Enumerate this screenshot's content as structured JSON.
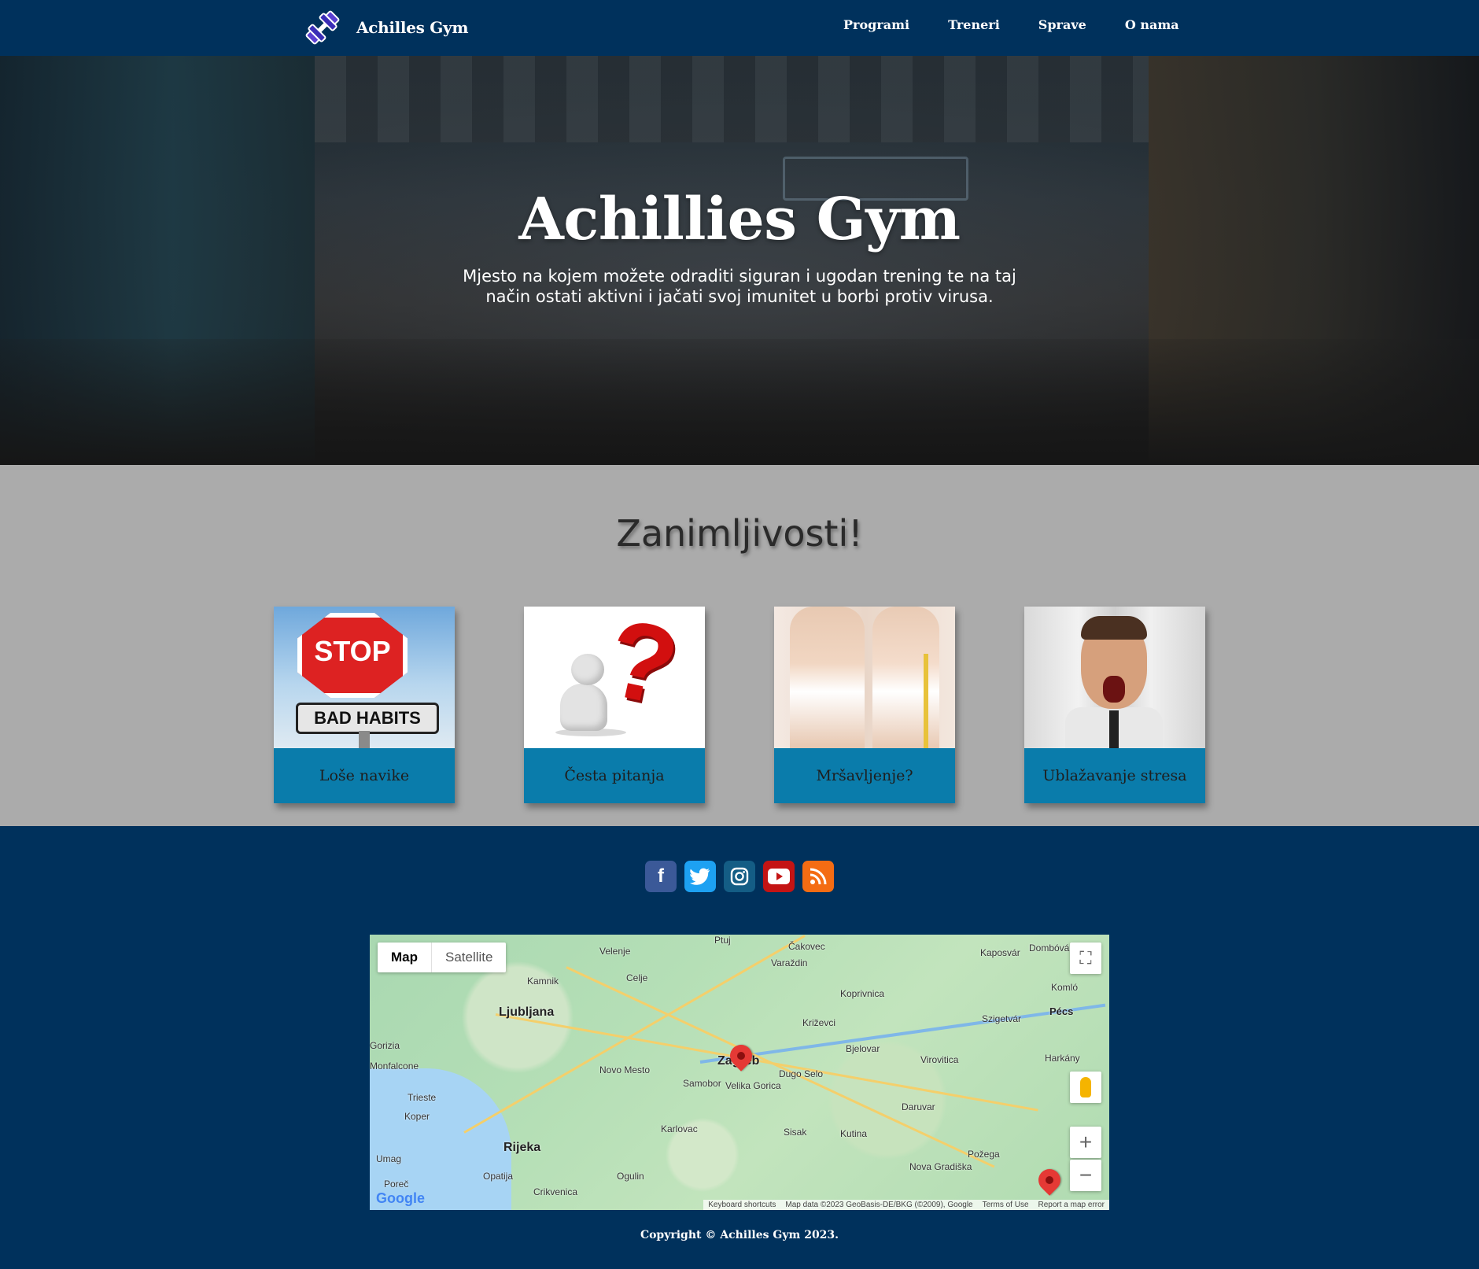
{
  "nav": {
    "brand": "Achilles Gym",
    "logo_icon": "dumbbell-logo-icon",
    "links": [
      "Programi",
      "Treneri",
      "Sprave",
      "O nama"
    ]
  },
  "hero": {
    "title": "Achillies Gym",
    "subtitle": "Mjesto na kojem možete odraditi siguran i ugodan trening te na taj način ostati aktivni i jačati svoj imunitet u borbi protiv virusa.",
    "image_text": [
      "STOP"
    ]
  },
  "section": {
    "title": "Zanimljivosti!",
    "cards": [
      {
        "label": "Loše navike",
        "image_text": "BAD HABITS"
      },
      {
        "label": "Česta pitanja"
      },
      {
        "label": "Mršavljenje?"
      },
      {
        "label": "Ublažavanje stresa"
      }
    ]
  },
  "footer": {
    "socials": [
      "facebook-icon",
      "twitter-icon",
      "instagram-icon",
      "youtube-icon",
      "rss-icon"
    ],
    "map": {
      "tab_map": "Map",
      "tab_satellite": "Satellite",
      "cities": [
        "Ljubljana",
        "Zagreb",
        "Rijeka",
        "Novo Mesto",
        "Samobor",
        "Velika Gorica",
        "Dugo Selo",
        "Karlovac",
        "Sisak",
        "Kutina",
        "Bjelovar",
        "Koprivnica",
        "Križevci",
        "Varaždin",
        "Čakovec",
        "Celje",
        "Kamnik",
        "Velenje",
        "Virovitica",
        "Daruvar",
        "Požega",
        "Nova Gradiška",
        "Pécs",
        "Kaposvár",
        "Szigetvár",
        "Harkány",
        "Trieste",
        "Koper",
        "Umag",
        "Poreč",
        "Opatija",
        "Crikvenica",
        "Ogulin",
        "Ptuj",
        "Dombóvár",
        "Komló",
        "Monfalcone",
        "Gorizia"
      ],
      "attribution": [
        "Keyboard shortcuts",
        "Map data ©2023 GeoBasis-DE/BKG (©2009), Google",
        "Terms of Use",
        "Report a map error"
      ],
      "logo": "Google"
    },
    "copyright": "Copyright © Achilles Gym 2023."
  }
}
